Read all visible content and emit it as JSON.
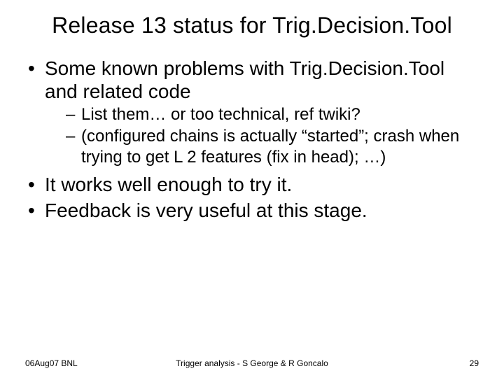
{
  "title": "Release 13 status for Trig.Decision.Tool",
  "bullets": {
    "b1": "Some known problems with Trig.Decision.Tool and related code",
    "b1_1": "List them… or too technical, ref twiki?",
    "b1_2": "(configured chains is actually “started”; crash when trying to get L 2 features (fix in head); …)",
    "b2": "It works well enough to try it.",
    "b3": "Feedback is very useful at this stage."
  },
  "footer": {
    "left": "06Aug07 BNL",
    "center": "Trigger analysis - S George & R Goncalo",
    "right": "29"
  }
}
